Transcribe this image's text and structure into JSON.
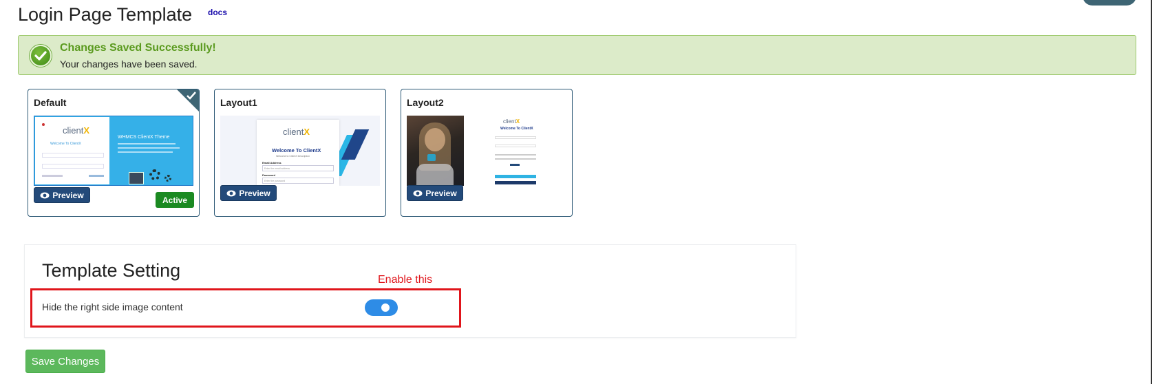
{
  "header": {
    "title": "Login Page Template",
    "docs_link": "docs"
  },
  "alert": {
    "title": "Changes Saved Successfully!",
    "message": "Your changes have been saved.",
    "icon": "check-circle-icon",
    "color": "#5a9a1e"
  },
  "templates": [
    {
      "name": "Default",
      "preview_label": "Preview",
      "active_label": "Active",
      "selected": true,
      "thumb": {
        "logo": "client",
        "logo_x": "X",
        "welcome": "Welcome To ClientX",
        "banner_title": "WHMCS ClientX Theme"
      }
    },
    {
      "name": "Layout1",
      "preview_label": "Preview",
      "selected": false,
      "thumb": {
        "logo": "client",
        "logo_x": "X",
        "welcome": "Welcome To ClientX",
        "subtitle": "Welcome to ClientX Description",
        "email_label": "Email Address",
        "email_placeholder": "Enter the email address",
        "password_label": "Password",
        "password_placeholder": "Enter the password"
      }
    },
    {
      "name": "Layout2",
      "preview_label": "Preview",
      "selected": false,
      "thumb": {
        "logo": "client",
        "logo_x": "X",
        "welcome": "Welcome To ClientX"
      }
    }
  ],
  "settings": {
    "title": "Template Setting",
    "hide_image_label": "Hide the right side image content",
    "hide_image_enabled": true,
    "annotation": "Enable this"
  },
  "actions": {
    "save_label": "Save Changes"
  },
  "colors": {
    "accent": "#234a7a",
    "success": "#5cb85c",
    "toggle": "#2e8ce6",
    "annotation": "#e0151b"
  }
}
